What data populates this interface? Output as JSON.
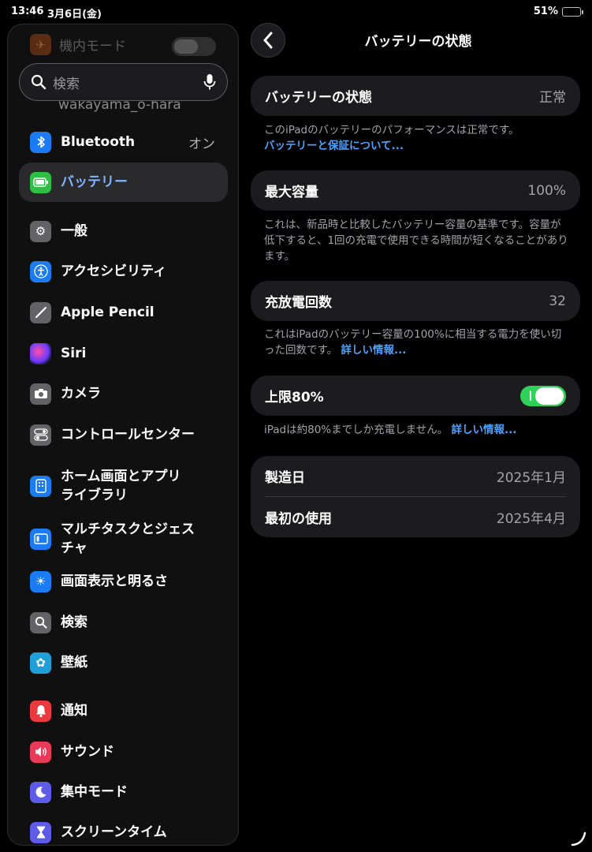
{
  "status": {
    "time": "13:46",
    "date": "3月6日(金)",
    "battery_percent": "51%",
    "battery_level": 0.51
  },
  "sidebar": {
    "airplane_label": "機内モード",
    "account_label": "wakayama_o-hara",
    "search_placeholder": "検索",
    "items": [
      {
        "label": "Bluetooth",
        "value": "オン",
        "icon": "bluetooth-icon",
        "color": "#1a7bf2"
      },
      {
        "label": "バッテリー",
        "icon": "battery-icon",
        "color": "#2fbf47",
        "selected": true
      },
      {
        "label": "一般",
        "icon": "gear-icon",
        "color": "#636366"
      },
      {
        "label": "アクセシビリティ",
        "icon": "accessibility-icon",
        "color": "#1a7bf2"
      },
      {
        "label": "Apple Pencil",
        "icon": "pencil-icon",
        "color": "#636366"
      },
      {
        "label": "Siri",
        "icon": "siri-icon",
        "color": "#2a1a44"
      },
      {
        "label": "カメラ",
        "icon": "camera-icon",
        "color": "#636366"
      },
      {
        "label": "コントロールセンター",
        "icon": "control-center-icon",
        "color": "#636366"
      },
      {
        "label": "ホーム画面とアプリ\nライブラリ",
        "label_line1": "ホーム画面とアプリ",
        "label_line2": "ライブラリ",
        "icon": "home-screen-icon",
        "color": "#1a7bf2"
      },
      {
        "label_line1": "マルチタスクとジェス",
        "label_line2": "チャ",
        "icon": "multitasking-icon",
        "color": "#1a7bf2"
      },
      {
        "label": "画面表示と明るさ",
        "icon": "brightness-icon",
        "color": "#1a7bf2"
      },
      {
        "label": "検索",
        "icon": "search-icon",
        "color": "#636366"
      },
      {
        "label": "壁紙",
        "icon": "wallpaper-icon",
        "color": "#1e9fd8"
      },
      {
        "label": "通知",
        "icon": "bell-icon",
        "color": "#ea3a3f"
      },
      {
        "label": "サウンド",
        "icon": "speaker-icon",
        "color": "#ea3a5a"
      },
      {
        "label": "集中モード",
        "icon": "moon-icon",
        "color": "#5e5ce6"
      },
      {
        "label": "スクリーンタイム",
        "icon": "hourglass-icon",
        "color": "#5e5ce6"
      }
    ]
  },
  "main": {
    "title": "バッテリーの状態",
    "health": {
      "label": "バッテリーの状態",
      "value": "正常"
    },
    "health_note": "このiPadのバッテリーのパフォーマンスは正常です。",
    "health_link": "バッテリーと保証について...",
    "capacity": {
      "label": "最大容量",
      "value": "100%"
    },
    "capacity_note": "これは、新品時と比較したバッテリー容量の基準です。容量が低下すると、1回の充電で使用できる時間が短くなることがあります。",
    "cycles": {
      "label": "充放電回数",
      "value": "32"
    },
    "cycles_note": "これはiPadのバッテリー容量の100%に相当する電力を使い切った回数です。",
    "cycles_link": "詳しい情報...",
    "limit": {
      "label": "上限80%",
      "on": true
    },
    "limit_note": "iPadは約80%までしか充電しません。",
    "limit_link": "詳しい情報...",
    "manufacture": {
      "label": "製造日",
      "value": "2025年1月"
    },
    "first_use": {
      "label": "最初の使用",
      "value": "2025年4月"
    }
  }
}
